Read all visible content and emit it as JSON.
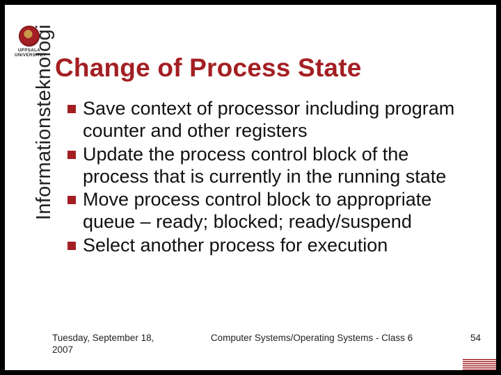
{
  "logo": {
    "org_line1": "UPPSALA",
    "org_line2": "UNIVERSITET"
  },
  "title": "Change of Process State",
  "sidebar_label": "Informationsteknologi",
  "bullets": [
    "Save context of processor including program counter and other registers",
    "Update the process control block of the process that is currently in the running state",
    "Move process control block to appropriate queue – ready; blocked; ready/suspend",
    "Select another process for execution"
  ],
  "footer": {
    "date": "Tuesday, September 18, 2007",
    "center": "Computer Systems/Operating Systems - Class 6",
    "page": "54"
  },
  "colors": {
    "accent": "#a31f23"
  }
}
